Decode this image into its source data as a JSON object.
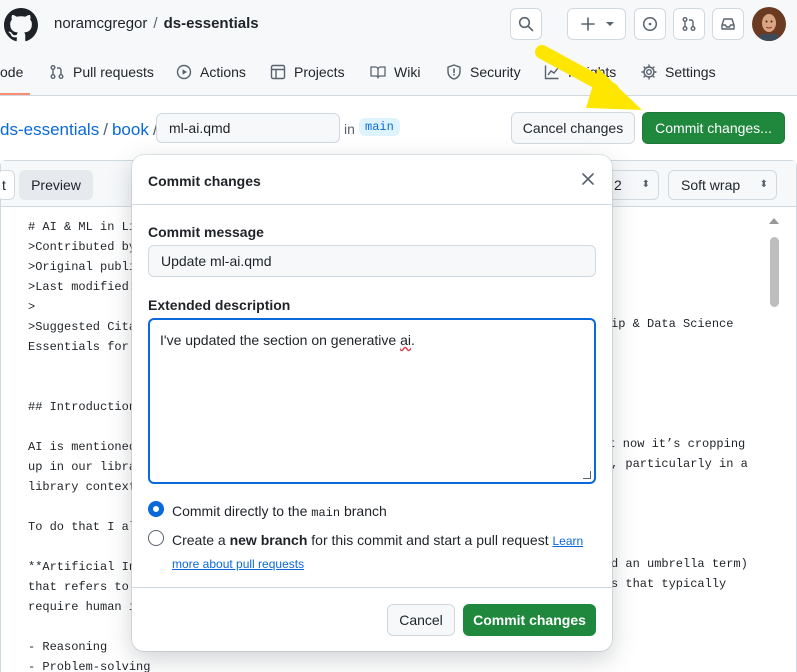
{
  "header": {
    "owner": "noramcgregor",
    "separator": "/",
    "repo": "ds-essentials"
  },
  "nav": {
    "tabs": [
      {
        "label": "ode",
        "icon": "code-icon"
      },
      {
        "label": "Pull requests",
        "icon": "pull-request-icon"
      },
      {
        "label": "Actions",
        "icon": "play-icon"
      },
      {
        "label": "Projects",
        "icon": "table-icon"
      },
      {
        "label": "Wiki",
        "icon": "book-icon"
      },
      {
        "label": "Security",
        "icon": "shield-icon"
      },
      {
        "label": "Insights",
        "icon": "graph-icon"
      },
      {
        "label": "Settings",
        "icon": "gear-icon"
      }
    ]
  },
  "editor_toolbar": {
    "crumb_repo": "ds-essentials",
    "crumb_sep1": "/",
    "crumb_dir": "book",
    "crumb_sep2": "/",
    "filename": "ml-ai.qmd",
    "in_label": "in",
    "branch": "main",
    "cancel_label": "Cancel changes",
    "commit_label": "Commit changes..."
  },
  "editor": {
    "tab_edit": "t",
    "tab_preview": "Preview",
    "indent_value": "2",
    "wrap_value": "Soft wrap",
    "code_lines": [
      "# AI & ML in Lib",
      ">Contributed by:",
      ">Original publis",
      ">Last modified: ",
      "> ",
      ">Suggested Citat",
      "Essentials for L",
      "",
      "",
      "## Introduction:",
      "",
      "AI is mentioned ",
      "up in our librar",
      "library context?",
      "",
      "To do that I alw",
      "",
      "**Artificial Int",
      "that refers to t",
      "require human in",
      "",
      "- Reasoning",
      "- Problem-solving"
    ],
    "code_right": {
      "line6": "ip & Data Science",
      "line12": "but now it’s cropping",
      "line13": ", particularly in a",
      "line18": "d an umbrella term)",
      "line19": "s that typically"
    }
  },
  "modal": {
    "title": "Commit changes",
    "message_label": "Commit message",
    "message_value": "Update ml-ai.qmd",
    "description_label": "Extended description",
    "description_before": "I've updated the section on generative ",
    "description_spell": "ai",
    "description_after": ".",
    "option1_prefix": "Commit directly to the ",
    "option1_branch": "main",
    "option1_suffix": " branch",
    "option2_prefix": "Create a ",
    "option2_bold": "new branch",
    "option2_suffix": " for this commit and start a pull request ",
    "option2_link": "Learn more about pull requests",
    "cancel_label": "Cancel",
    "commit_label": "Commit changes"
  },
  "colors": {
    "primary_green": "#1f883d",
    "link_blue": "#0969da",
    "annotation_arrow": "#ffe600"
  }
}
